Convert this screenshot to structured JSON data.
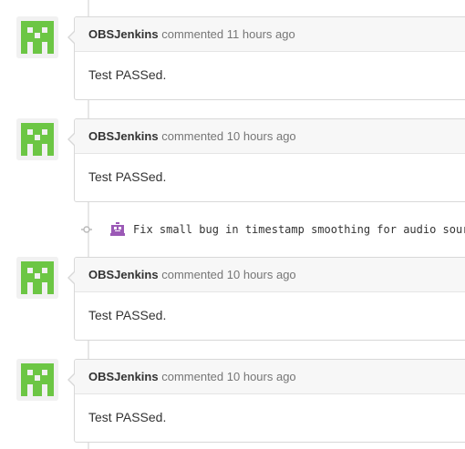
{
  "comments": [
    {
      "author": "OBSJenkins",
      "action": "commented",
      "time": "11 hours ago",
      "body": "Test PASSed."
    },
    {
      "author": "OBSJenkins",
      "action": "commented",
      "time": "10 hours ago",
      "body": "Test PASSed."
    },
    {
      "author": "OBSJenkins",
      "action": "commented",
      "time": "10 hours ago",
      "body": "Test PASSed."
    },
    {
      "author": "OBSJenkins",
      "action": "commented",
      "time": "10 hours ago",
      "body": "Test PASSed."
    }
  ],
  "commit": {
    "message": "Fix small bug in timestamp smoothing for audio sour",
    "icon": "commit-icon",
    "avatar_icon": "robot-avatar-icon"
  },
  "colors": {
    "avatar_green": "#6cc644",
    "avatar_bg": "#f1f1f1",
    "commit_avatar_purple": "#9b59b6"
  }
}
